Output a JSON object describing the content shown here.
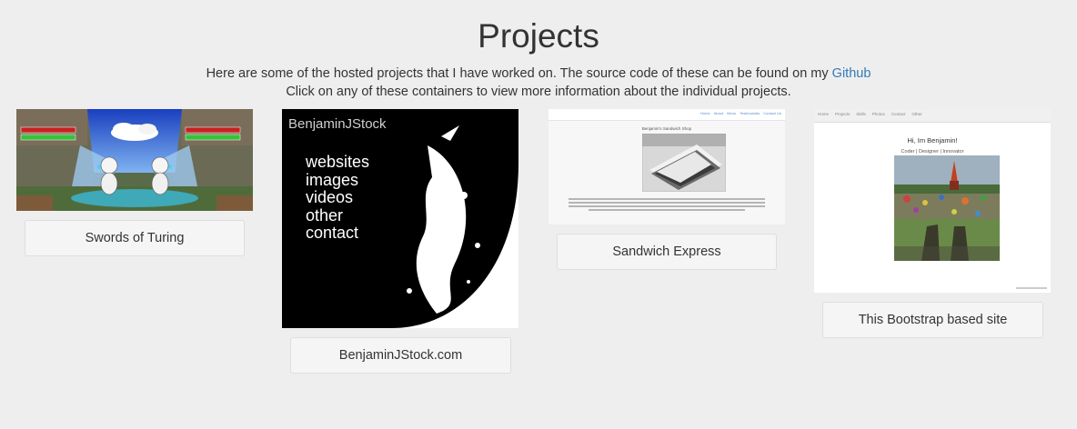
{
  "page": {
    "title": "Projects",
    "intro_line1_text": "Here are some of the hosted projects that I have worked on. The source code of these can be found on my",
    "intro_link": "Github",
    "intro_line2": "Click on any of these containers to view more information about the individual projects."
  },
  "projects": [
    {
      "caption": "Swords of Turing"
    },
    {
      "caption": "BenjaminJStock.com",
      "thumb": {
        "brand": "BenjaminJStock",
        "menu": [
          "websites",
          "images",
          "videos",
          "other",
          "contact"
        ]
      }
    },
    {
      "caption": "Sandwich Express",
      "thumb": {
        "site_title": "Benjamin's Sandwich Shop",
        "nav": [
          "Home",
          "About",
          "Menu",
          "Testimonials",
          "Contact Us"
        ]
      }
    },
    {
      "caption": "This Bootstrap based site",
      "thumb": {
        "nav": [
          "Home",
          "Projects",
          "Skills",
          "Photos",
          "Contact",
          "Other"
        ],
        "heading": "Hi, Im Benjamin!",
        "sub": "Coder | Designer | Innovator"
      }
    }
  ],
  "colors": {
    "background": "#eeeeee",
    "link": "#337ab7",
    "button_bg": "#f5f5f5"
  }
}
